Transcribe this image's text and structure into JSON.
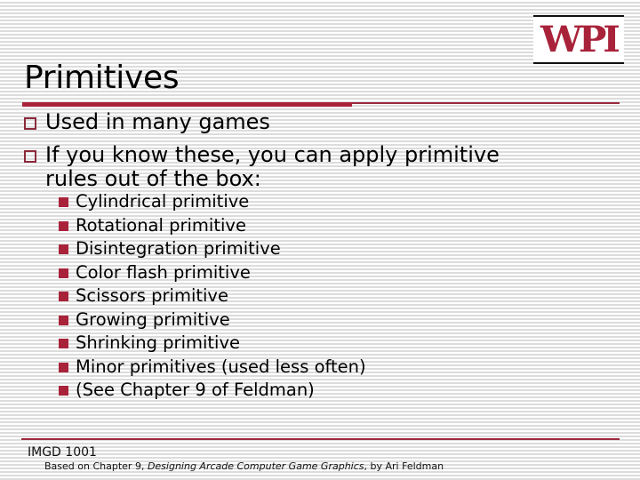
{
  "logo": {
    "text": "WPI",
    "color": "#a8233a"
  },
  "slide": {
    "title": "Primitives",
    "bullets": [
      {
        "text": "Used in many games"
      },
      {
        "text": "If you know these, you can apply primitive",
        "continuation": "rules out of the box:"
      }
    ],
    "sub_bullets": [
      "Cylindrical primitive",
      "Rotational primitive",
      "Disintegration primitive",
      "Color flash primitive",
      "Scissors primitive",
      "Growing primitive",
      "Shrinking primitive",
      "Minor primitives (used less often)",
      "(See Chapter 9 of Feldman)"
    ]
  },
  "footer": {
    "course": "IMGD 1001",
    "credit_prefix": "Based on Chapter 9, ",
    "credit_title": "Designing Arcade Computer Game Graphics",
    "credit_suffix": ", by Ari Feldman"
  },
  "colors": {
    "accent": "#a8233a",
    "bullet_outline": "#8b2a3a",
    "stripe": "#dcdcdc"
  }
}
